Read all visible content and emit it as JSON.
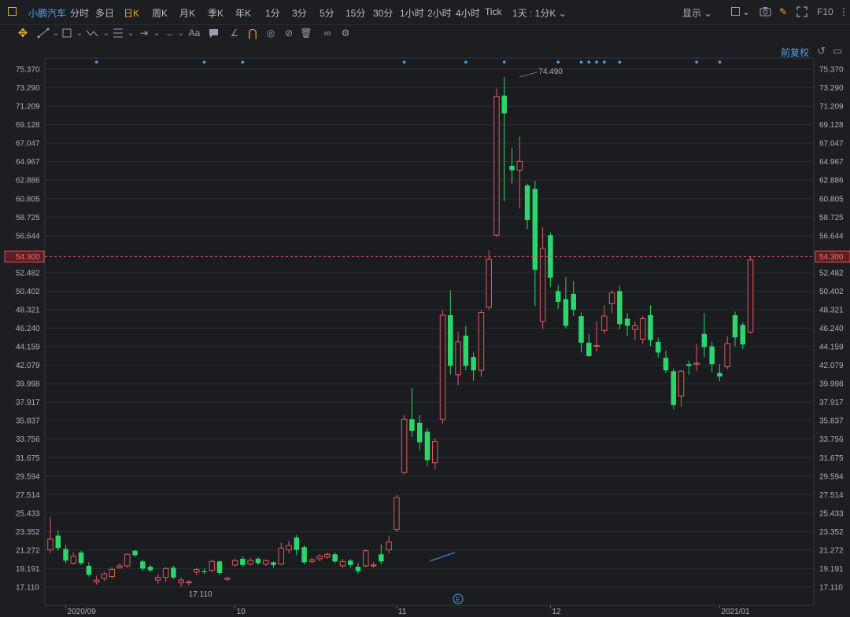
{
  "header": {
    "symbol_name": "小鹏汽车",
    "periods": [
      {
        "label": "分时",
        "active": false
      },
      {
        "label": "多日",
        "active": false
      },
      {
        "label": "日K",
        "active": true
      },
      {
        "label": "周K",
        "active": false
      },
      {
        "label": "月K",
        "active": false
      },
      {
        "label": "季K",
        "active": false
      },
      {
        "label": "年K",
        "active": false
      },
      {
        "label": "1分",
        "active": false
      },
      {
        "label": "3分",
        "active": false
      },
      {
        "label": "5分",
        "active": false
      },
      {
        "label": "15分",
        "active": false
      },
      {
        "label": "30分",
        "active": false
      },
      {
        "label": "1小时",
        "active": false
      },
      {
        "label": "2小时",
        "active": false
      },
      {
        "label": "4小时",
        "active": false
      },
      {
        "label": "Tick",
        "active": false
      }
    ],
    "multi_period": "1天 : 1分K",
    "display_label": "显示",
    "f10_label": "F10"
  },
  "toolbar": {
    "tools": [
      "move-icon",
      "line-draw-icon",
      "rectangle-icon",
      "polyline-icon",
      "fib-icon",
      "range-icon",
      "arrow-icon",
      "text-icon",
      "note-icon",
      "angle-icon",
      "magnet-icon",
      "eye-icon",
      "hide-icon",
      "trash-icon",
      "link-icon",
      "settings-icon"
    ],
    "text_tool_label": "Aa",
    "restore_label": "前复权"
  },
  "colors": {
    "up": "#e05a5a",
    "down": "#2bd66b",
    "current_price": "#d9565c",
    "marker": "#4aa3f0",
    "accent": "#f0a929"
  },
  "chart_data": {
    "type": "candlestick",
    "ylim": [
      15.03,
      77.45
    ],
    "y_ticks": [
      "75.370",
      "73.290",
      "71.209",
      "69.128",
      "67.047",
      "64.967",
      "62.886",
      "60.805",
      "58.725",
      "56.644",
      "52.482",
      "50.402",
      "48.321",
      "46.240",
      "44.159",
      "42.079",
      "39.998",
      "37.917",
      "35.837",
      "33.756",
      "31.675",
      "29.594",
      "27.514",
      "25.433",
      "23.352",
      "21.272",
      "19.191",
      "17.110"
    ],
    "current_price": "54.300",
    "x_labels": [
      {
        "label": "2020/09",
        "index": 2
      },
      {
        "label": "10",
        "index": 24
      },
      {
        "label": "11",
        "index": 45
      },
      {
        "label": "12",
        "index": 65
      },
      {
        "label": "2021/01",
        "index": 87
      }
    ],
    "max_label": "74.490",
    "max_index": 61,
    "min_label": "17.110",
    "min_index": 19,
    "event_badge": "E",
    "event_index": 53,
    "top_marker_indices": [
      6,
      20,
      25,
      46,
      54,
      59,
      66,
      69,
      70,
      71,
      72,
      74,
      84,
      87
    ],
    "candles": [
      [
        21.3,
        22.5,
        20.9,
        25.0
      ],
      [
        22.9,
        21.5,
        21.2,
        23.5
      ],
      [
        21.4,
        20.1,
        19.8,
        21.9
      ],
      [
        19.8,
        20.6,
        19.6,
        21.0
      ],
      [
        21.0,
        19.8,
        19.6,
        21.2
      ],
      [
        19.5,
        18.5,
        18.3,
        19.9
      ],
      [
        17.7,
        17.9,
        17.4,
        18.4
      ],
      [
        18.1,
        18.6,
        17.8,
        18.8
      ],
      [
        18.3,
        19.1,
        18.1,
        19.4
      ],
      [
        19.3,
        19.5,
        19.2,
        19.8
      ],
      [
        19.5,
        20.8,
        19.3,
        20.9
      ],
      [
        21.2,
        20.7,
        20.5,
        21.3
      ],
      [
        20.0,
        19.2,
        18.9,
        20.2
      ],
      [
        19.4,
        19.0,
        18.8,
        19.6
      ],
      [
        17.9,
        18.2,
        17.5,
        18.6
      ],
      [
        18.2,
        19.2,
        17.7,
        19.4
      ],
      [
        19.3,
        18.2,
        18.0,
        19.5
      ],
      [
        17.6,
        17.9,
        17.11,
        18.2
      ],
      [
        17.6,
        17.7,
        17.3,
        17.9
      ],
      [
        18.8,
        19.1,
        18.5,
        19.3
      ],
      [
        18.9,
        18.8,
        18.6,
        19.2
      ],
      [
        19.0,
        20.0,
        18.8,
        20.2
      ],
      [
        20.0,
        18.7,
        18.5,
        20.1
      ],
      [
        18.0,
        18.1,
        17.8,
        18.3
      ],
      [
        19.6,
        20.1,
        19.4,
        20.3
      ],
      [
        20.3,
        19.6,
        19.4,
        20.6
      ],
      [
        19.7,
        20.1,
        19.5,
        20.4
      ],
      [
        20.3,
        19.8,
        19.6,
        20.5
      ],
      [
        19.7,
        20.1,
        19.5,
        20.2
      ],
      [
        19.9,
        19.6,
        19.3,
        20.0
      ],
      [
        19.7,
        21.5,
        19.6,
        22.1
      ],
      [
        21.3,
        21.8,
        20.9,
        22.3
      ],
      [
        22.7,
        21.3,
        20.7,
        23.0
      ],
      [
        21.6,
        19.9,
        19.7,
        21.8
      ],
      [
        20.0,
        20.2,
        19.8,
        20.4
      ],
      [
        20.3,
        20.6,
        20.0,
        20.8
      ],
      [
        20.5,
        20.8,
        20.3,
        21.0
      ],
      [
        20.8,
        20.0,
        19.8,
        21.0
      ],
      [
        19.5,
        20.0,
        19.3,
        20.3
      ],
      [
        20.1,
        19.6,
        19.3,
        20.3
      ],
      [
        19.4,
        18.9,
        18.6,
        19.8
      ],
      [
        19.5,
        21.2,
        19.3,
        21.4
      ],
      [
        19.5,
        19.6,
        19.3,
        19.9
      ],
      [
        20.8,
        20.0,
        19.7,
        21.9
      ],
      [
        21.3,
        22.2,
        20.9,
        22.9
      ],
      [
        23.6,
        27.2,
        23.3,
        27.5
      ],
      [
        30.0,
        36.0,
        29.8,
        36.5
      ],
      [
        36.0,
        34.7,
        34.0,
        39.5
      ],
      [
        35.6,
        33.4,
        32.5,
        36.5
      ],
      [
        34.6,
        31.4,
        30.7,
        35.0
      ],
      [
        31.1,
        33.5,
        30.4,
        33.9
      ],
      [
        36.0,
        47.7,
        35.5,
        48.3
      ],
      [
        47.7,
        42.0,
        41.0,
        50.5
      ],
      [
        41.0,
        44.7,
        39.8,
        45.8
      ],
      [
        45.4,
        42.0,
        41.5,
        46.5
      ],
      [
        43.0,
        41.5,
        40.3,
        43.5
      ],
      [
        41.5,
        48.0,
        40.8,
        48.3
      ],
      [
        48.6,
        54.0,
        48.3,
        55.0
      ],
      [
        56.7,
        72.3,
        56.5,
        73.2
      ],
      [
        72.4,
        70.4,
        60.5,
        74.49
      ],
      [
        64.5,
        64.0,
        62.5,
        66.5
      ],
      [
        64.0,
        65.0,
        59.7,
        67.8
      ],
      [
        62.3,
        58.4,
        57.4,
        62.5
      ],
      [
        61.9,
        52.8,
        48.7,
        62.8
      ],
      [
        47.0,
        55.2,
        46.1,
        57.6
      ],
      [
        56.7,
        51.9,
        50.9,
        57.0
      ],
      [
        50.4,
        49.2,
        48.4,
        51.1
      ],
      [
        49.5,
        46.5,
        46.2,
        52.0
      ],
      [
        50.1,
        48.3,
        47.6,
        51.5
      ],
      [
        47.6,
        44.6,
        43.5,
        48.0
      ],
      [
        44.6,
        43.1,
        43.0,
        45.6
      ],
      [
        44.2,
        44.3,
        43.6,
        47.0
      ],
      [
        46.0,
        47.6,
        45.6,
        48.8
      ],
      [
        49.0,
        50.2,
        47.9,
        50.5
      ],
      [
        50.4,
        46.7,
        46.1,
        51.0
      ],
      [
        47.3,
        46.5,
        45.4,
        47.9
      ],
      [
        46.1,
        46.5,
        44.9,
        47.0
      ],
      [
        45.0,
        47.3,
        44.5,
        47.6
      ],
      [
        47.7,
        44.9,
        44.2,
        48.8
      ],
      [
        44.7,
        43.5,
        42.9,
        45.2
      ],
      [
        42.9,
        41.5,
        41.2,
        43.7
      ],
      [
        41.4,
        37.6,
        37.1,
        41.7
      ],
      [
        38.6,
        41.4,
        37.4,
        41.5
      ],
      [
        42.2,
        42.0,
        41.0,
        42.6
      ],
      [
        42.2,
        42.3,
        41.4,
        44.5
      ],
      [
        45.6,
        44.1,
        43.0,
        47.9
      ],
      [
        44.2,
        42.2,
        41.3,
        44.7
      ],
      [
        41.2,
        40.8,
        40.3,
        42.2
      ],
      [
        41.9,
        44.5,
        41.6,
        45.3
      ],
      [
        47.7,
        45.2,
        44.2,
        48.1
      ],
      [
        46.6,
        44.4,
        43.9,
        46.9
      ],
      [
        45.8,
        53.9,
        45.6,
        54.3
      ]
    ]
  }
}
